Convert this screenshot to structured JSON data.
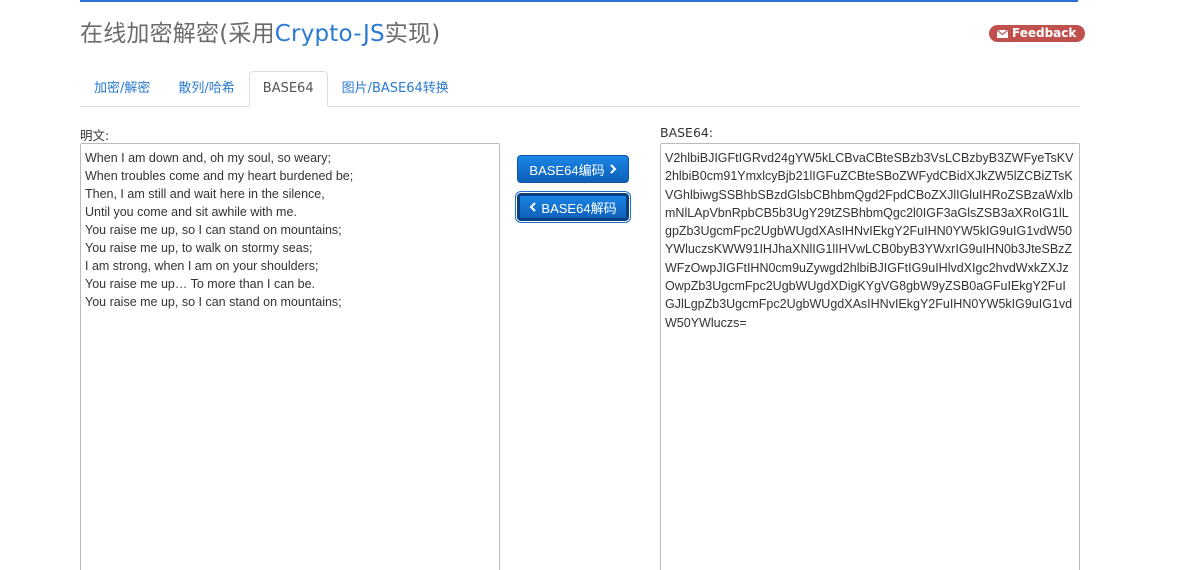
{
  "header": {
    "title_prefix": "在线加密解密(采用",
    "title_accent": "Crypto-JS",
    "title_suffix": "实现)",
    "feedback_label": "Feedback"
  },
  "tabs": [
    {
      "label": "加密/解密",
      "active": false
    },
    {
      "label": "散列/哈希",
      "active": false
    },
    {
      "label": "BASE64",
      "active": true
    },
    {
      "label": "图片/BASE64转换",
      "active": false
    }
  ],
  "plaintext": {
    "label": "明文:",
    "lines": [
      "When I am down and, oh my soul, so weary;",
      "When troubles come and my heart burdened be;",
      "Then, I am still and wait here in the silence,",
      "Until you come and sit awhile with me.",
      "You raise me up, so I can stand on mountains;",
      "You raise me up, to walk on stormy seas;",
      "I am strong, when I am on your shoulders;",
      "You raise me up… To more than I can be.",
      "You raise me up, so I can stand on mountains;"
    ]
  },
  "actions": {
    "encode_label": "BASE64编码",
    "decode_label": "BASE64解码"
  },
  "base64": {
    "label": "BASE64:",
    "value": "V2hlbiBJIGFtIGRvd24gYW5kLCBvaCBteSBzb3VsLCBzbyB3ZWFyeTsKV2hlbiB0cm91YmxlcyBjb21lIGFuZCBteSBoZWFydCBidXJkZW5lZCBiZTsKVGhlbiwgSSBhbSBzdGlsbCBhbmQgd2FpdCBoZXJlIGluIHRoZSBzaWxlbmNlLApVbnRpbCB5b3UgY29tZSBhbmQgc2l0IGF3aGlsZSB3aXRoIG1lLgpZb3UgcmFpc2UgbWUgdXAsIHNvIEkgY2FuIHN0YW5kIG9uIG1vdW50YWluczsKWW91IHJhaXNlIG1lIHVwLCB0byB3YWxrIG9uIHN0b3JteSBzZWFzOwpJIGFtIHN0cm9uZywgd2hlbiBJIGFtIG9uIHlvdXIgc2hvdWxkZXJzOwpZb3UgcmFpc2UgbWUgdXDigKYgVG8gbW9yZSB0aGFuIEkgY2FuIGJlLgpZb3UgcmFpc2UgbWUgdXAsIHNvIEkgY2FuIHN0YW5kIG9uIG1vdW50YWluczs="
  },
  "colors": {
    "accent": "#2a7ad1",
    "feedback_badge": "#c0504d",
    "button": "#0e6fd1"
  }
}
